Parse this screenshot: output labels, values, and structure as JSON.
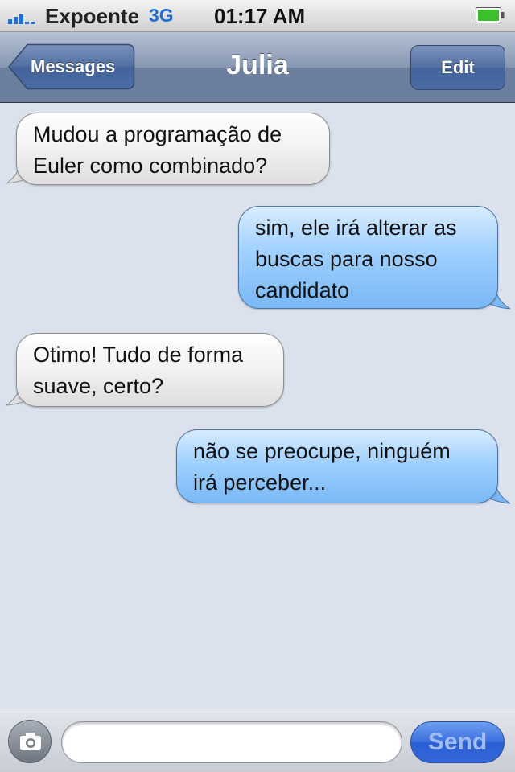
{
  "status_bar": {
    "carrier": "Expoente",
    "network": "3G",
    "time": "01:17 AM"
  },
  "navbar": {
    "back_label": "Messages",
    "title": "Julia",
    "edit_label": "Edit"
  },
  "messages": [
    {
      "direction": "incoming",
      "lines": [
        "Mudou a programação de",
        "Euler como combinado?"
      ]
    },
    {
      "direction": "outgoing",
      "lines": [
        "sim, ele irá alterar as",
        "buscas para nosso",
        "candidato"
      ]
    },
    {
      "direction": "incoming",
      "lines": [
        "Otimo! Tudo de forma",
        "suave, certo?"
      ]
    },
    {
      "direction": "outgoing",
      "lines": [
        "não se preocupe, ninguém",
        "irá perceber..."
      ]
    }
  ],
  "input_bar": {
    "message_value": "",
    "send_label": "Send"
  },
  "colors": {
    "outgoing_bubble": "#9fd0ff",
    "incoming_bubble": "#f3f3f3",
    "send_button": "#3a6ee0",
    "battery": "#3bbf2a"
  },
  "icons": [
    "signal-bars-icon",
    "battery-icon",
    "back-arrow-icon",
    "camera-icon"
  ]
}
